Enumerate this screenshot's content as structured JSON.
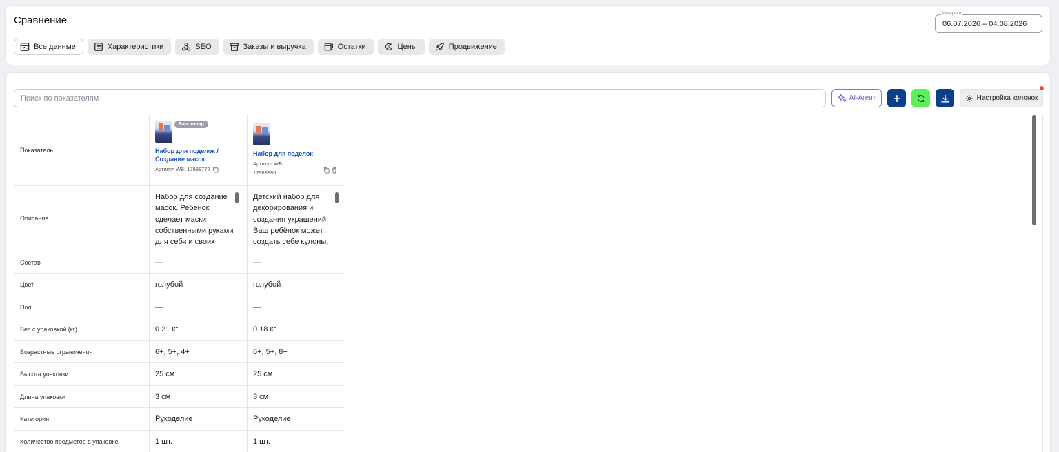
{
  "page": {
    "title": "Сравнение",
    "interval_label": "Интервал",
    "interval_value": "06.07.2026 – 04.08.2026"
  },
  "tabs": [
    {
      "label": "Все данные",
      "icon": "table-icon",
      "active": true
    },
    {
      "label": "Характеристики",
      "icon": "card-icon",
      "active": false
    },
    {
      "label": "SEO",
      "icon": "network-icon",
      "active": false
    },
    {
      "label": "Заказы и выручка",
      "icon": "box-icon",
      "active": false
    },
    {
      "label": "Остатки",
      "icon": "stock-icon",
      "active": false
    },
    {
      "label": "Цены",
      "icon": "price-cycle-icon",
      "active": false
    },
    {
      "label": "Продвижение",
      "icon": "rocket-icon",
      "active": false
    }
  ],
  "toolbar": {
    "search_placeholder": "Поиск по показателям",
    "ai_label": "AI-Агент",
    "columns_label": "Настройка колонок"
  },
  "colors": {
    "primary": "#0b3f8a",
    "refresh": "#5df05a",
    "ai": "#7b57c7",
    "link": "#1b56b3",
    "notification": "#e84c3d"
  },
  "table": {
    "header_label": "Показатель",
    "products": [
      {
        "badge": "Ваш товар",
        "name": "Набор для поделок / Создание масок",
        "sku": "Артикул WB: 17988772"
      },
      {
        "badge": "",
        "name": "Набор для поделок",
        "sku": "Артикул WB: 17988885"
      }
    ],
    "description": {
      "label": "Описание",
      "a": "Набор для создание масок. Ребенок сделает маски собственными руками для себя и своих",
      "b": "Детский набор для декорирования и создания украшений! Ваш ребёнок может создать себе кулоны,"
    },
    "rows": [
      {
        "label": "Состав",
        "a": "—",
        "b": "—"
      },
      {
        "label": "Цвет",
        "a": "голубой",
        "b": "голубой"
      },
      {
        "label": "Пол",
        "a": "—",
        "b": "—"
      },
      {
        "label": "Вес с упаковкой (кг)",
        "a": "0.21 кг",
        "b": "0.18 кг"
      },
      {
        "label": "Возрастные ограничения",
        "a": "6+, 5+, 4+",
        "b": "6+, 5+, 8+"
      },
      {
        "label": "Высота упаковки",
        "a": "25 см",
        "b": "25 см"
      },
      {
        "label": "Длина упаковки",
        "a": "3 см",
        "b": "3 см"
      },
      {
        "label": "Категория",
        "a": "Рукоделие",
        "b": "Рукоделие"
      },
      {
        "label": "Количество предметов в упаковке",
        "a": "1 шт.",
        "b": "1 шт."
      }
    ]
  }
}
